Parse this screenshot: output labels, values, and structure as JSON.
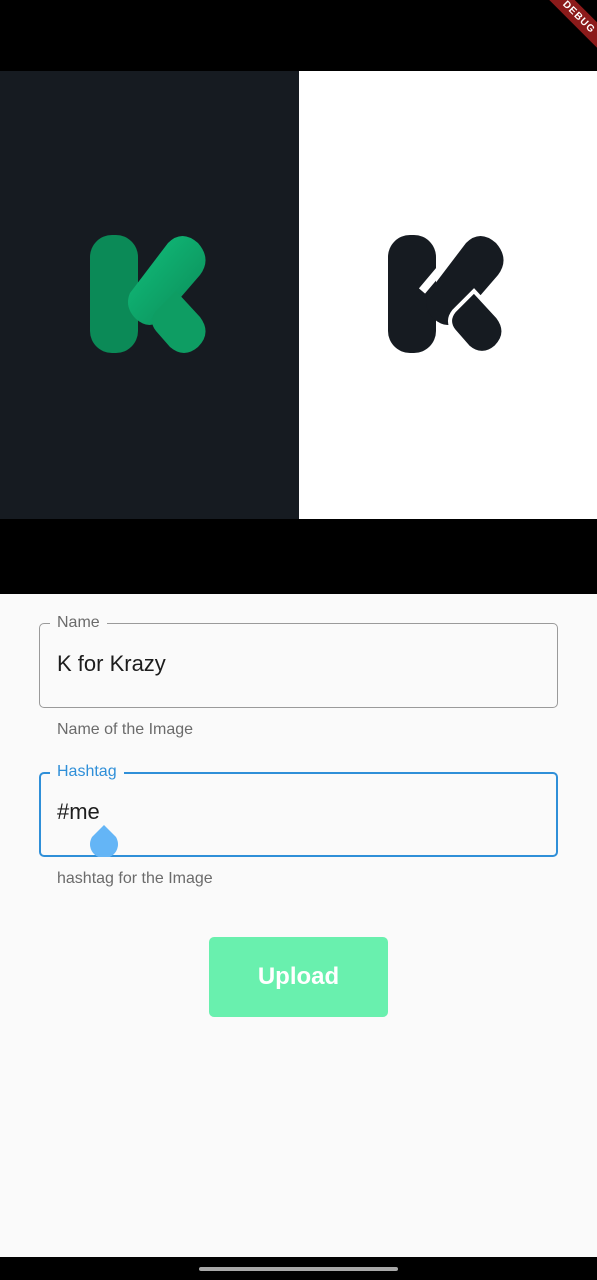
{
  "status_bar": {
    "debug_banner": "DEBUG"
  },
  "preview": {
    "logos": [
      {
        "name": "k-logo-green",
        "icon": "k-logo-icon",
        "colors": [
          "#0b8a57",
          "#11c07c"
        ],
        "background": "#161b21"
      },
      {
        "name": "k-logo-black",
        "icon": "k-logo-icon",
        "colors": [
          "#161b21"
        ],
        "background": "#ffffff"
      }
    ]
  },
  "form": {
    "name_field": {
      "label": "Name",
      "value": "K for Krazy",
      "helper": "Name of the Image"
    },
    "hashtag_field": {
      "label": "Hashtag",
      "value": "#me",
      "helper": "hashtag for the Image",
      "focused": true
    },
    "upload_button": {
      "label": "Upload",
      "color": "#69f0ae"
    }
  },
  "colors": {
    "accent": "#2f8fd8",
    "form_background": "#fafafa"
  }
}
